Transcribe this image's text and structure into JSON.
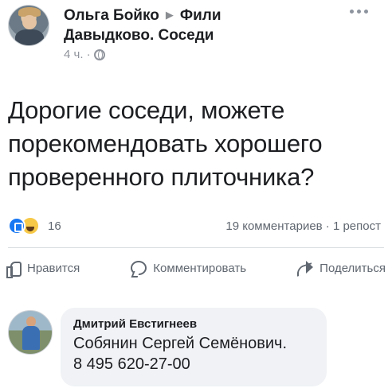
{
  "post": {
    "author": "Ольга Бойко",
    "group_line1": "Фили",
    "group_line2": "Давыдково. Соседи",
    "time": "4 ч. ·",
    "message": "Дорогие соседи, можете порекомендовать хорошего проверенного плиточника?"
  },
  "reactions": {
    "count": "16",
    "stats": "19 комментариев · 1 репост"
  },
  "actions": {
    "like": "Нравится",
    "comment": "Комментировать",
    "share": "Поделиться"
  },
  "comment": {
    "author": "Дмитрий Евстигнеев",
    "line1": "Собянин Сергей Семёнович.",
    "line2": "8 495 620-27-00"
  },
  "colors": {
    "like_blue": "#1877f2",
    "haha_yellow": "#f7c948",
    "meta_gray": "#90949c",
    "bubble_bg": "#f0f2f5"
  },
  "icons": [
    "globe-icon",
    "more-icon",
    "like-reaction-icon",
    "haha-reaction-icon",
    "thumbs-up-icon",
    "comment-icon",
    "share-icon"
  ]
}
